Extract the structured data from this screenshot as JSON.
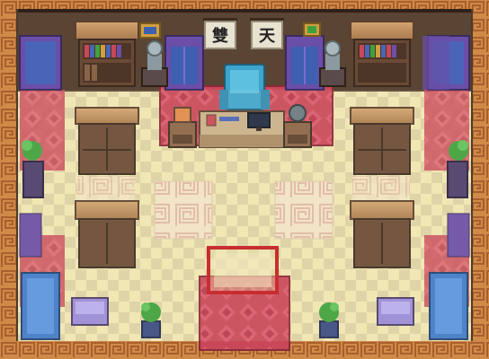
{
  "room": {
    "banner_left": "雙",
    "banner_right": "天"
  },
  "colors": {
    "floor_light": "#efe6b3",
    "floor_dark": "#d8cda0",
    "wall": "#4d3a2b",
    "border_orange": "#d08a48",
    "border_dark": "#a95f2e",
    "rug_red": "#c8485a",
    "rug_pink": "#e26a82",
    "wood": "#8a6447",
    "wood_dark": "#5c3f2d",
    "glass_blue": "#4a64b8",
    "chair_cyan": "#3ea4cc",
    "plant_green": "#3fa13b",
    "window_purple": "#6a4ea8"
  },
  "icons": [
    "bookshelf-icon",
    "statue-icon",
    "plant-icon",
    "computer-icon",
    "chair-icon",
    "globe-icon",
    "painting-icon",
    "cabinet-icon"
  ]
}
